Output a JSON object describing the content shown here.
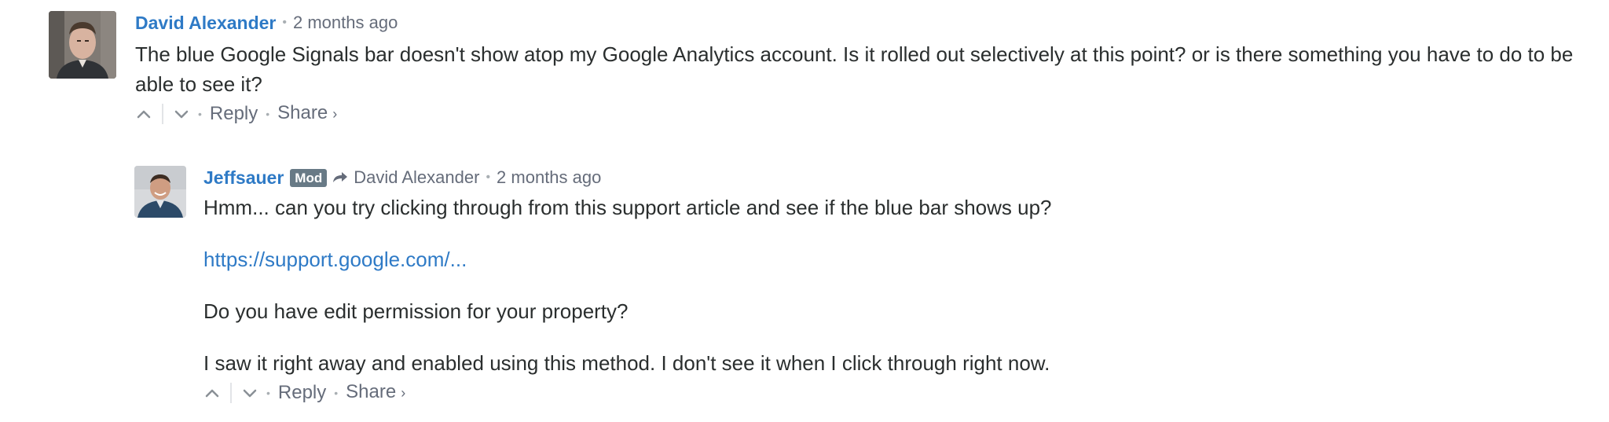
{
  "comments": [
    {
      "author": "David Alexander",
      "time": "2 months ago",
      "text": "The blue Google Signals bar doesn't show atop my Google Analytics account. Is it rolled out selectively at this point? or is there something you have to do to be able to see it?",
      "actions": {
        "reply": "Reply",
        "share": "Share",
        "share_chevron": "›"
      }
    },
    {
      "author": "Jeffsauer",
      "badge": "Mod",
      "reply_to": "David Alexander",
      "time": "2 months ago",
      "paragraphs": {
        "p1": "Hmm... can you try clicking through from this support article and see if the blue bar shows up?",
        "link": "https://support.google.com/...",
        "p2": "Do you have edit permission for your property?",
        "p3": "I saw it right away and enabled using this method. I don't see it when I click through right now."
      },
      "actions": {
        "reply": "Reply",
        "share": "Share",
        "share_chevron": "›"
      }
    }
  ],
  "separator": "•",
  "colors": {
    "author": "#2e7ac6",
    "link": "#2e7ac6",
    "meta": "#656c7a",
    "text": "#2a2e2e",
    "badge_bg": "#687a86"
  },
  "icons": {
    "upvote": "chevron-up-icon",
    "downvote": "chevron-down-icon",
    "reply_to": "reply-arrow-icon"
  }
}
